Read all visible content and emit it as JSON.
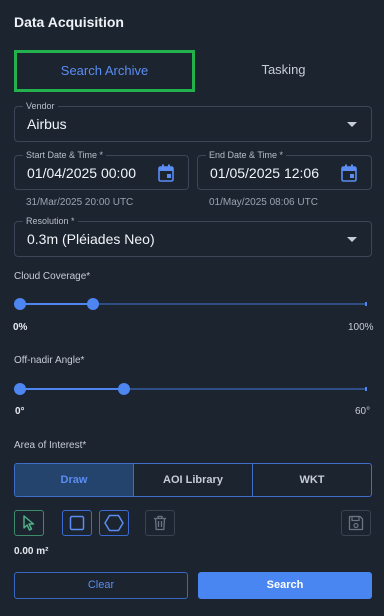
{
  "panel": {
    "title": "Data Acquisition"
  },
  "tabs": {
    "search_archive": "Search Archive",
    "tasking": "Tasking",
    "active": "Search Archive"
  },
  "vendor": {
    "label": "Vendor",
    "value": "Airbus",
    "icon": "chevron-down-icon"
  },
  "start_date": {
    "label": "Start Date & Time *",
    "value": "01/04/2025 00:00",
    "utc": "31/Mar/2025 20:00 UTC",
    "icon": "calendar-icon"
  },
  "end_date": {
    "label": "End Date & Time *",
    "value": "01/05/2025 12:06",
    "utc": "01/May/2025 08:06 UTC",
    "icon": "calendar-icon"
  },
  "resolution": {
    "label": "Resolution *",
    "value": "0.3m (Pléiades Neo)",
    "icon": "chevron-down-icon"
  },
  "cloud_coverage": {
    "label": "Cloud Coverage*",
    "min_label": "0%",
    "max_label": "100%",
    "min": 0,
    "max": 100,
    "range_low": 0,
    "range_high": 21
  },
  "off_nadir": {
    "label": "Off-nadir Angle*",
    "min_label": "0°",
    "max_label": "60°",
    "min": 0,
    "max": 60,
    "range_low": 0,
    "range_high": 18
  },
  "aoi": {
    "label": "Area of Interest*",
    "modes": [
      "Draw",
      "AOI Library",
      "WKT"
    ],
    "active_mode": "Draw",
    "tools": [
      "pointer-icon",
      "rectangle-icon",
      "polygon-icon",
      "trash-icon",
      "save-icon"
    ],
    "area": "0.00 m²"
  },
  "actions": {
    "clear": "Clear",
    "search": "Search"
  },
  "colors": {
    "accent": "#4a86f2",
    "highlight": "#22b14c",
    "background": "#1c2430"
  }
}
